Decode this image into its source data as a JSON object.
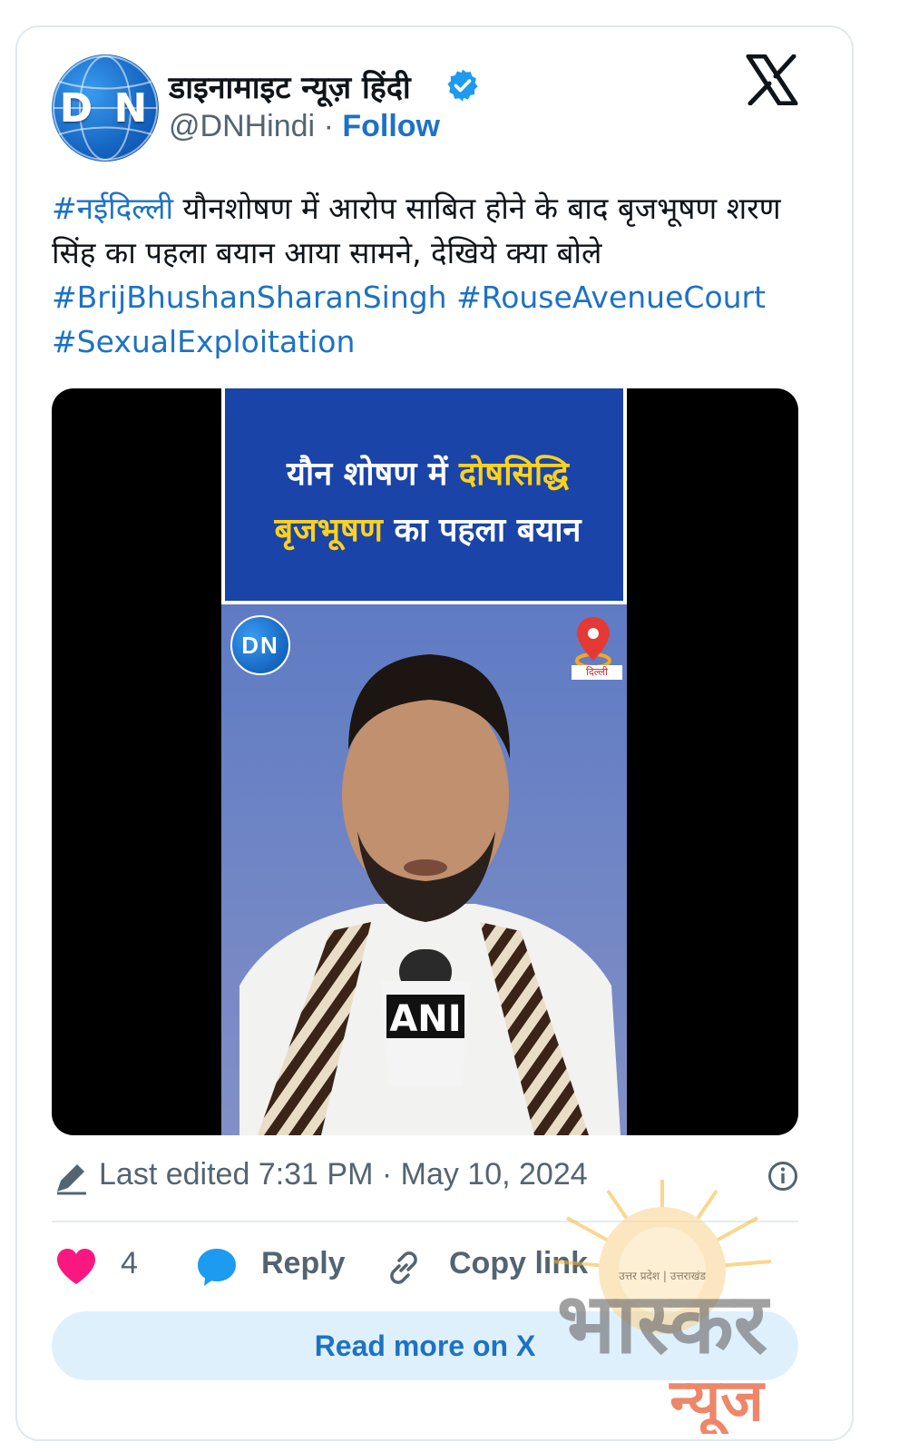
{
  "author": {
    "display_name": "डाइनामाइट न्यूज़ हिंदी",
    "handle": "@DNHindi",
    "separator": "·",
    "follow_label": "Follow",
    "avatar_text": "D N"
  },
  "tweet": {
    "hashtag_city": "#नईदिल्ली",
    "body": " यौनशोषण में आरोप साबित होने के बाद बृजभूषण शरण सिंह का पहला बयान आया सामने, देखिये क्या बोले",
    "hashtags": [
      "#BrijBhushanSharanSingh",
      "#RouseAvenueCourt",
      "#SexualExploitation"
    ]
  },
  "media": {
    "headline_part1": "यौन शोषण में ",
    "headline_highlight1": "दोषसिद्धि",
    "headline_highlight2": "बृजभूषण",
    "headline_part2": " का पहला बयान",
    "logo_text": "DN",
    "location_label": "दिल्ली",
    "mic_label": "ANI"
  },
  "meta": {
    "edited_text": "Last edited 7:31 PM · May 10, 2024"
  },
  "actions": {
    "like_count": "4",
    "reply_label": "Reply",
    "copy_link_label": "Copy link",
    "read_more_label": "Read more on X"
  },
  "watermark": {
    "main_text": "भास्कर",
    "sub_text": "न्यूज",
    "regions": "उत्तर प्रदेश | उत्तराखंड"
  },
  "colors": {
    "link_blue": "#1d72c4",
    "like_red": "#f91880",
    "verified_blue": "#1d9bf0",
    "video_blue": "#1a44a8",
    "highlight_yellow": "#ffd21a"
  },
  "icons": [
    "verified-badge-icon",
    "x-logo-icon",
    "pencil-icon",
    "info-icon",
    "heart-icon",
    "reply-bubble-icon",
    "link-icon",
    "location-pin-icon"
  ]
}
